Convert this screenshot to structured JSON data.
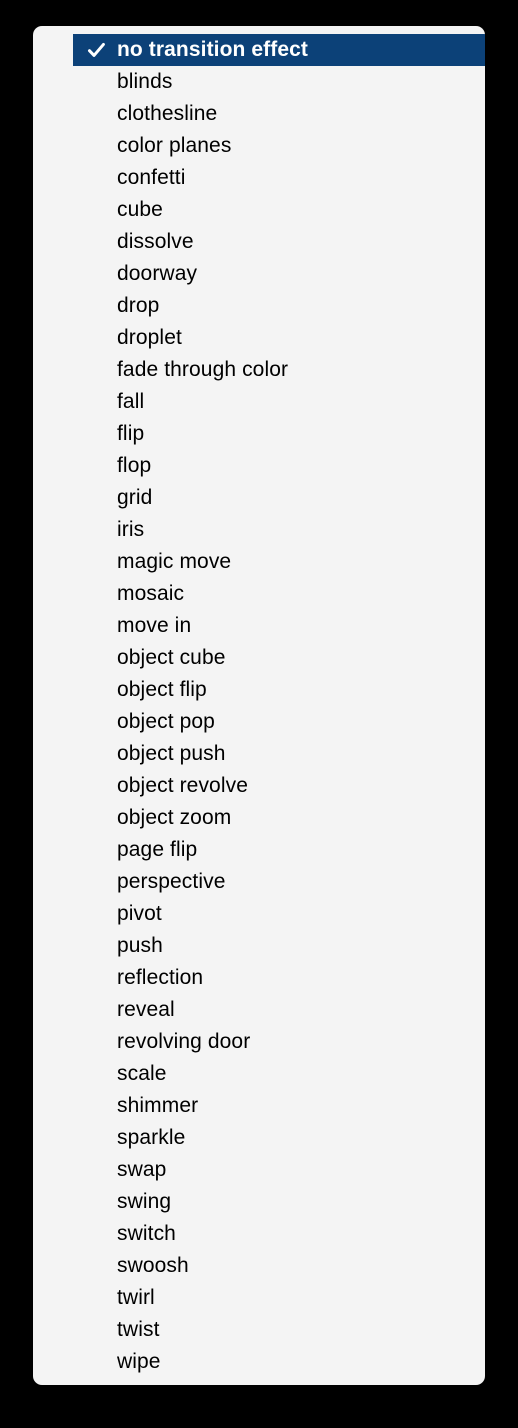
{
  "menu": {
    "name": "transition-effect-menu",
    "background_color": "#f4f4f4",
    "selection_color": "#0c4178",
    "selection_text_color": "#ffffff",
    "text_color": "#000000",
    "backdrop_color": "#000000",
    "selected_index": 0,
    "check_icon": "checkmark-icon",
    "items": [
      {
        "label": "no transition effect",
        "selected": true
      },
      {
        "label": "blinds",
        "selected": false
      },
      {
        "label": "clothesline",
        "selected": false
      },
      {
        "label": "color planes",
        "selected": false
      },
      {
        "label": "confetti",
        "selected": false
      },
      {
        "label": "cube",
        "selected": false
      },
      {
        "label": "dissolve",
        "selected": false
      },
      {
        "label": "doorway",
        "selected": false
      },
      {
        "label": "drop",
        "selected": false
      },
      {
        "label": "droplet",
        "selected": false
      },
      {
        "label": "fade through color",
        "selected": false
      },
      {
        "label": "fall",
        "selected": false
      },
      {
        "label": "flip",
        "selected": false
      },
      {
        "label": "flop",
        "selected": false
      },
      {
        "label": "grid",
        "selected": false
      },
      {
        "label": "iris",
        "selected": false
      },
      {
        "label": "magic move",
        "selected": false
      },
      {
        "label": "mosaic",
        "selected": false
      },
      {
        "label": "move in",
        "selected": false
      },
      {
        "label": "object cube",
        "selected": false
      },
      {
        "label": "object flip",
        "selected": false
      },
      {
        "label": "object pop",
        "selected": false
      },
      {
        "label": "object push",
        "selected": false
      },
      {
        "label": "object revolve",
        "selected": false
      },
      {
        "label": "object zoom",
        "selected": false
      },
      {
        "label": "page flip",
        "selected": false
      },
      {
        "label": "perspective",
        "selected": false
      },
      {
        "label": "pivot",
        "selected": false
      },
      {
        "label": "push",
        "selected": false
      },
      {
        "label": "reflection",
        "selected": false
      },
      {
        "label": "reveal",
        "selected": false
      },
      {
        "label": "revolving door",
        "selected": false
      },
      {
        "label": "scale",
        "selected": false
      },
      {
        "label": "shimmer",
        "selected": false
      },
      {
        "label": "sparkle",
        "selected": false
      },
      {
        "label": "swap",
        "selected": false
      },
      {
        "label": "swing",
        "selected": false
      },
      {
        "label": "switch",
        "selected": false
      },
      {
        "label": "swoosh",
        "selected": false
      },
      {
        "label": "twirl",
        "selected": false
      },
      {
        "label": "twist",
        "selected": false
      },
      {
        "label": "wipe",
        "selected": false
      }
    ]
  }
}
